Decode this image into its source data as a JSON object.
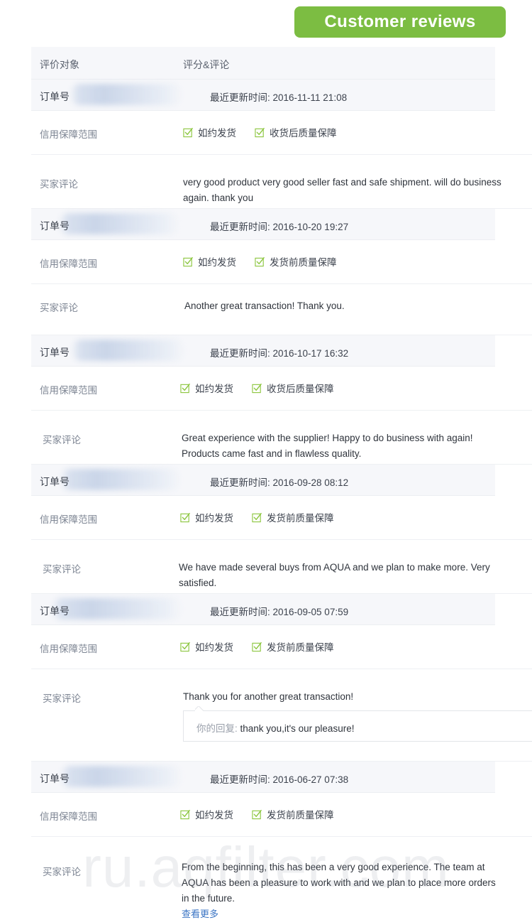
{
  "header": {
    "badge_label": "Customer reviews",
    "badge_color": "#7cbd42"
  },
  "table": {
    "columns": [
      "评价对象",
      "评分&评论"
    ],
    "labels": {
      "order_no": "订单号",
      "order_no_partial_1": "订单",
      "order_no_partial_2": "订单号",
      "guarantee": "信用保障范围",
      "comment": "买家评论"
    },
    "date_prefix": "最近更新时间:",
    "reply_prefix": "你的回复:",
    "more_link": "查看更多"
  },
  "reviews": [
    {
      "order_label": "订单号",
      "date": "最近更新时间: 2016-11-11 21:08",
      "guarantee_label": "信用保障范围",
      "chips": [
        "如约发货",
        "收货后质量保障"
      ],
      "comment_label": "买家评论",
      "comment": "very good product very good seller fast and safe shipment. will do business again. thank you",
      "reply": null
    },
    {
      "order_label": "订单号",
      "date": "最近更新时间: 2016-10-20 19:27",
      "guarantee_label": "信用保障范围",
      "chips": [
        "如约发货",
        "发货前质量保障"
      ],
      "comment_label": "买家评论",
      "comment": "Another great transaction! Thank you.",
      "reply": null
    },
    {
      "order_label": "订单号",
      "date": "最近更新时间: 2016-10-17 16:32",
      "guarantee_label": "信用保障范围",
      "chips": [
        "如约发货",
        "收货后质量保障"
      ],
      "comment_label": "买家评论",
      "comment": "Great experience with the supplier! Happy to do business with again! Products came fast and in flawless quality.",
      "reply": null
    },
    {
      "order_label": "订单号",
      "date": "最近更新时间: 2016-09-28 08:12",
      "guarantee_label": "信用保障范围",
      "chips": [
        "如约发货",
        "发货前质量保障"
      ],
      "comment_label": "买家评论",
      "comment": "We have made several buys from AQUA and we plan to make more. Very satisfied.",
      "reply": null
    },
    {
      "order_label": "订单号",
      "date": "最近更新时间: 2016-09-05 07:59",
      "guarantee_label": "信用保障范围",
      "chips": [
        "如约发货",
        "发货前质量保障"
      ],
      "comment_label": "买家评论",
      "comment": "Thank you for another great transaction!",
      "reply": {
        "prefix": "你的回复:",
        "text": "thank you,it's our pleasure!"
      }
    },
    {
      "order_label": "订单号",
      "date": "最近更新时间: 2016-06-27 07:38",
      "guarantee_label": "信用保障范围",
      "chips": [
        "如约发货",
        "发货前质量保障"
      ],
      "comment_label": "买家评论",
      "comment": "From the beginning, this has been a very good experience. The team at AQUA has been a pleasure to work with and we plan to place more orders in the future.",
      "reply": null,
      "more_link": "查看更多"
    }
  ],
  "watermark": {
    "text": "ru.aqfilter.com"
  },
  "icons": {
    "check": "checkbox-checked-icon"
  }
}
